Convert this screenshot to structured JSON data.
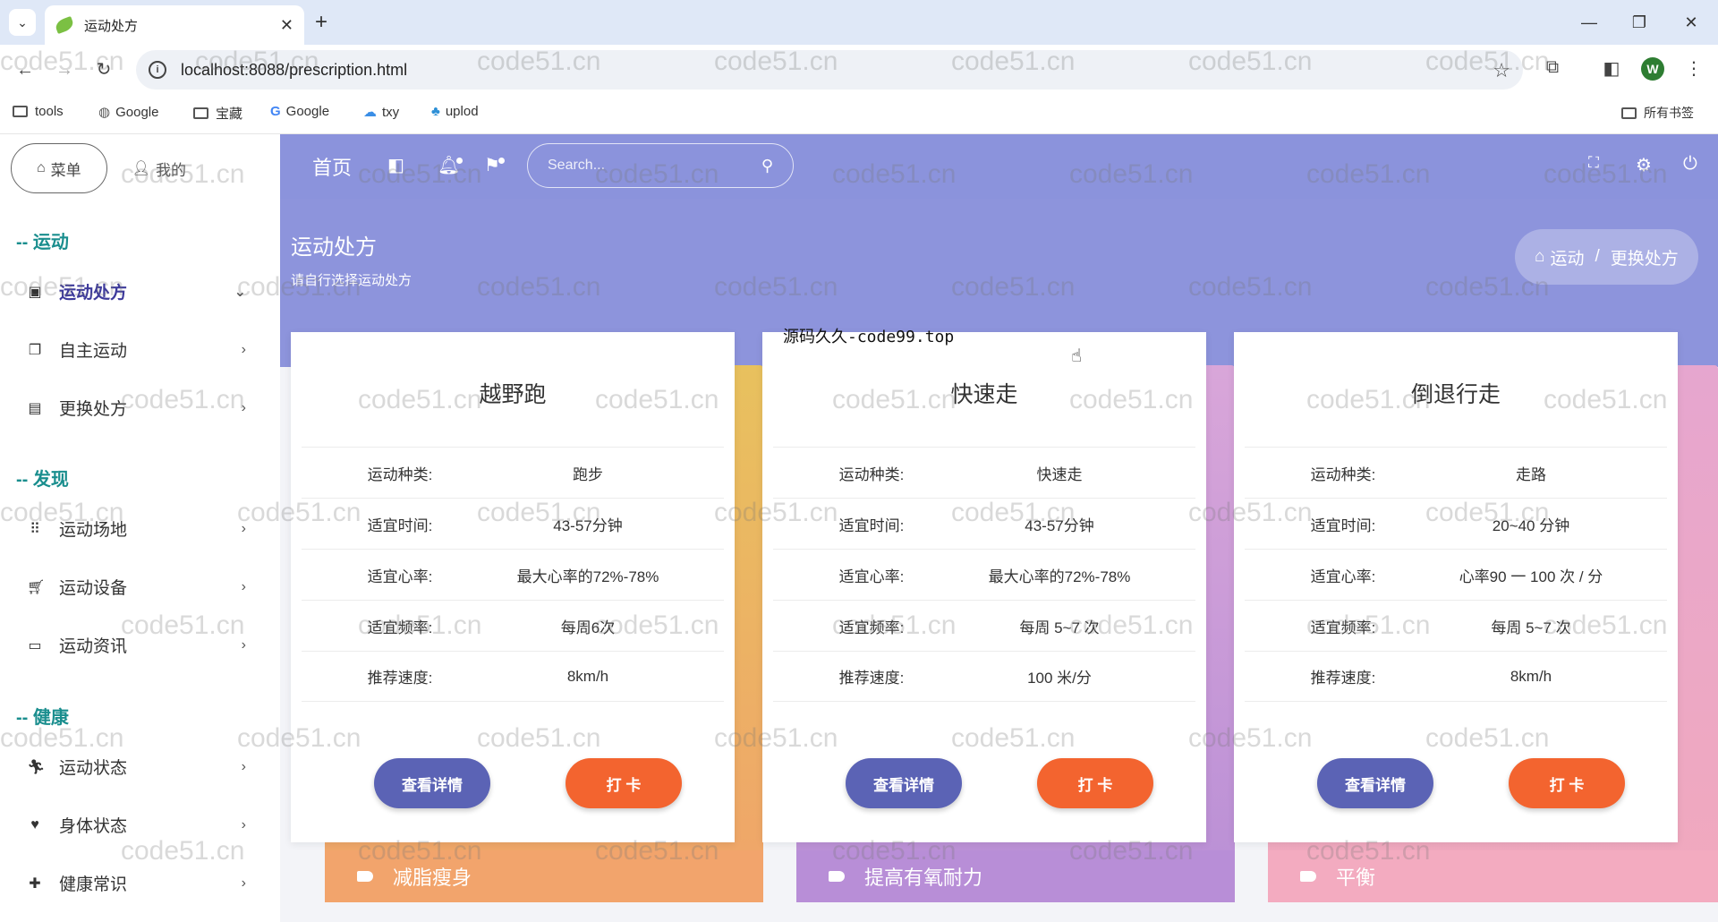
{
  "browser": {
    "tab_title": "运动处方",
    "url": "localhost:8088/prescription.html",
    "profile_initial": "W",
    "bookmarks": [
      "tools",
      "Google",
      "宝藏",
      "Google",
      "txy",
      "uplod"
    ],
    "all_bookmarks": "所有书签"
  },
  "sidebar": {
    "tabs": [
      "菜单",
      "我的"
    ],
    "sections": [
      {
        "title": "-- 运动",
        "items": [
          "运动处方",
          "自主运动",
          "更换处方"
        ]
      },
      {
        "title": "-- 发现",
        "items": [
          "运动场地",
          "运动设备",
          "运动资讯"
        ]
      },
      {
        "title": "-- 健康",
        "items": [
          "运动状态",
          "身体状态",
          "健康常识"
        ]
      }
    ]
  },
  "topnav": {
    "home": "首页",
    "search_placeholder": "Search..."
  },
  "hero": {
    "title": "运动处方",
    "subtitle": "请自行选择运动处方",
    "breadcrumb": [
      "运动",
      "/",
      "更换处方"
    ]
  },
  "cards": [
    {
      "title": "越野跑",
      "rows": [
        {
          "k": "运动种类:",
          "v": "跑步"
        },
        {
          "k": "适宜时间:",
          "v": "43-57分钟"
        },
        {
          "k": "适宜心率:",
          "v": "最大心率的72%-78%"
        },
        {
          "k": "适宜频率:",
          "v": "每周6次"
        },
        {
          "k": "推荐速度:",
          "v": "8km/h"
        }
      ],
      "detail_btn": "查看详情",
      "punch_btn": "打 卡",
      "tag": "减脂瘦身"
    },
    {
      "title": "快速走",
      "rows": [
        {
          "k": "运动种类:",
          "v": "快速走"
        },
        {
          "k": "适宜时间:",
          "v": "43-57分钟"
        },
        {
          "k": "适宜心率:",
          "v": "最大心率的72%-78%"
        },
        {
          "k": "适宜频率:",
          "v": "每周 5~7 次"
        },
        {
          "k": "推荐速度:",
          "v": "100 米/分"
        }
      ],
      "detail_btn": "查看详情",
      "punch_btn": "打 卡",
      "tag": "提高有氧耐力"
    },
    {
      "title": "倒退行走",
      "rows": [
        {
          "k": "运动种类:",
          "v": "走路"
        },
        {
          "k": "适宜时间:",
          "v": "20~40 分钟"
        },
        {
          "k": "适宜心率:",
          "v": "心率90 一 100 次 / 分"
        },
        {
          "k": "适宜频率:",
          "v": "每周 5~7 次"
        },
        {
          "k": "推荐速度:",
          "v": "8km/h"
        }
      ],
      "detail_btn": "查看详情",
      "punch_btn": "打 卡",
      "tag": "平衡"
    }
  ],
  "overlay_text": "源码久久-code99.top",
  "watermark_text": "code51.cn",
  "colors": {
    "nav": "#8b93dc",
    "accent_teal": "#1a8e8e",
    "detail_btn": "#5b63b5",
    "punch_btn": "#f3642f",
    "band_orange": "#f0a46a",
    "band_purple": "#b98fd6",
    "band_pink": "#f1a9bd"
  }
}
